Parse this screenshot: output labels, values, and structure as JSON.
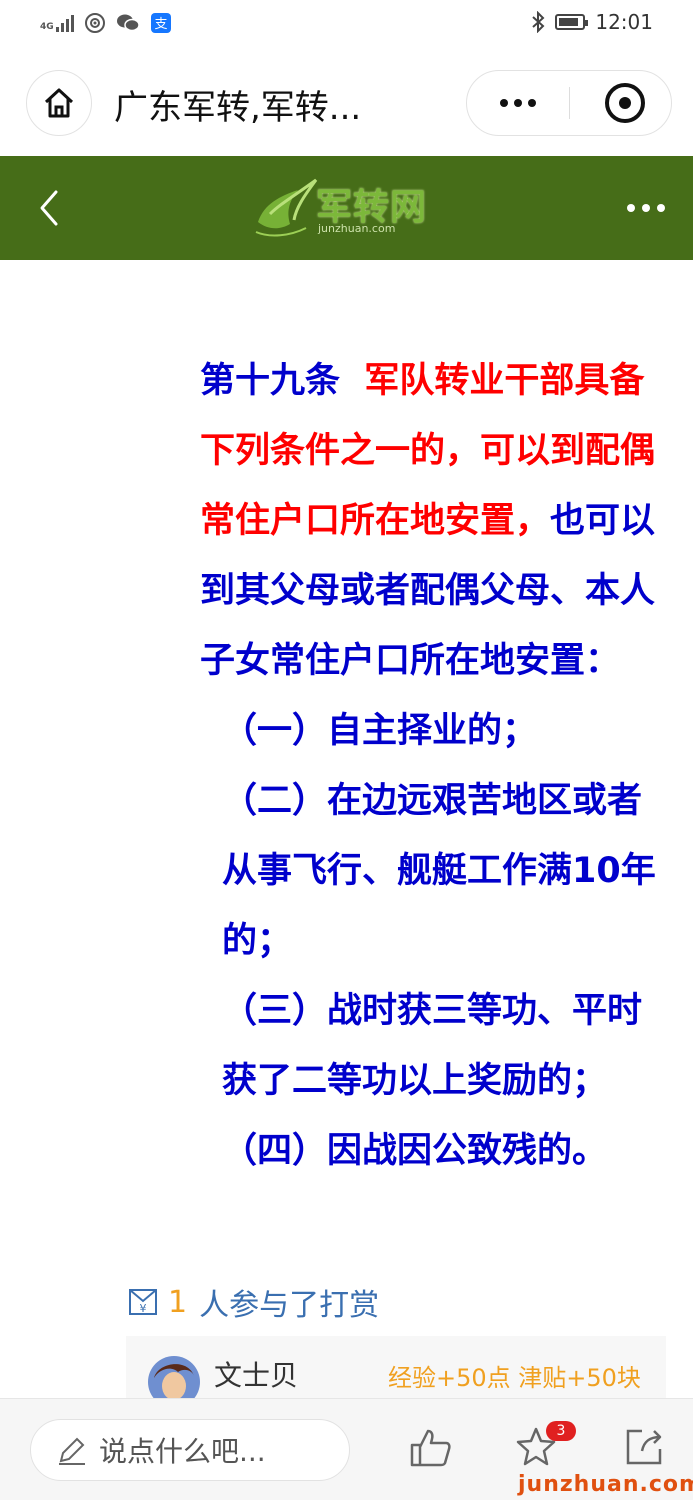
{
  "status_bar": {
    "network": "4G",
    "time": "12:01"
  },
  "mini_program": {
    "title": "广东军转,军转..."
  },
  "site": {
    "logo_text": "军转网",
    "logo_sub": "junzhuan.com",
    "header_color": "#466d18"
  },
  "article": {
    "p1_prefix": "第十九条",
    "p1_red": "军队转业干部具备下列条件之一的，可以到配偶常住户口所在地安置，",
    "p1_rest": "也可以到其父母或者配偶父母、本人子女常住户口所在地安置：",
    "item1": "（一）自主择业的；",
    "item2": "（二）在边远艰苦地区或者从事飞行、舰艇工作满10年的；",
    "item3": "（三）战时获三等功、平时获了二等功以上奖励的；",
    "item4": "（四）因战因公致残的。"
  },
  "reward": {
    "count": "1",
    "text": "人参与了打赏",
    "user_name": "文士贝",
    "user_reward": "经验+50点  津贴+50块"
  },
  "bottom_bar": {
    "comment_placeholder": "说点什么吧...",
    "favorite_badge": "3",
    "watermark": "junzhuan.com"
  },
  "colors": {
    "article_blue": "#0000cc",
    "article_red": "#ff0000",
    "accent_orange": "#f0a020"
  }
}
